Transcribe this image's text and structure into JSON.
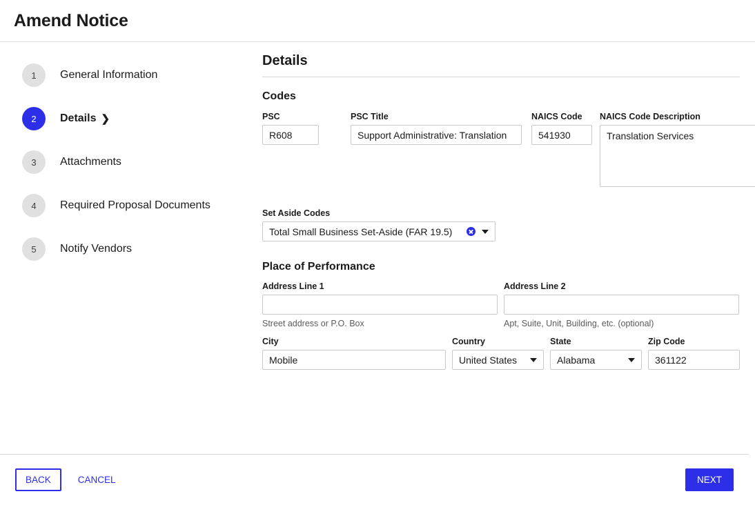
{
  "header": {
    "title": "Amend Notice"
  },
  "sidebar": {
    "steps": [
      {
        "number": "1",
        "label": "General Information",
        "active": false
      },
      {
        "number": "2",
        "label": "Details",
        "active": true,
        "chevron": "❯"
      },
      {
        "number": "3",
        "label": "Attachments",
        "active": false
      },
      {
        "number": "4",
        "label": "Required Proposal Documents",
        "active": false
      },
      {
        "number": "5",
        "label": "Notify Vendors",
        "active": false
      }
    ]
  },
  "main": {
    "section_title": "Details",
    "codes": {
      "title": "Codes",
      "psc_label": "PSC",
      "psc_value": "R608",
      "psc_title_label": "PSC Title",
      "psc_title_value": "Support Administrative: Translation",
      "naics_label": "NAICS Code",
      "naics_value": "541930",
      "naics_desc_label": "NAICS Code Description",
      "naics_desc_value": "Translation Services"
    },
    "set_aside": {
      "label": "Set Aside Codes",
      "value": "Total Small Business Set-Aside (FAR 19.5)"
    },
    "place_of_performance": {
      "title": "Place of Performance",
      "address1_label": "Address Line 1",
      "address1_value": "",
      "address1_helper": "Street address or P.O. Box",
      "address2_label": "Address Line 2",
      "address2_value": "",
      "address2_helper": "Apt, Suite, Unit, Building, etc. (optional)",
      "city_label": "City",
      "city_value": "Mobile",
      "country_label": "Country",
      "country_value": "United States",
      "state_label": "State",
      "state_value": "Alabama",
      "zip_label": "Zip Code",
      "zip_value": "361122"
    }
  },
  "footer": {
    "back_label": "BACK",
    "cancel_label": "CANCEL",
    "next_label": "NEXT"
  },
  "colors": {
    "accent": "#2d2ee8",
    "step_inactive": "#e0e0e0",
    "border": "#c9c9c9",
    "rule": "#d6d7d9"
  }
}
